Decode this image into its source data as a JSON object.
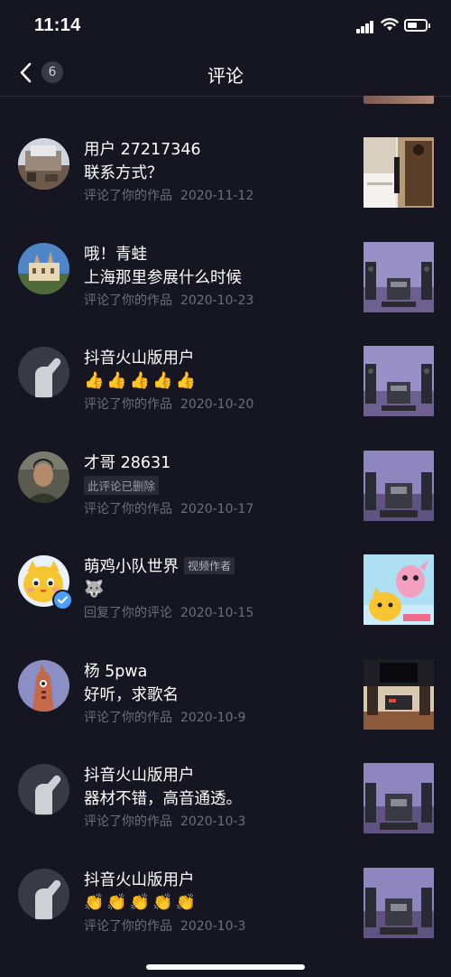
{
  "status_bar": {
    "time": "11:14"
  },
  "nav": {
    "title": "评论",
    "badge": "6"
  },
  "items": [
    {
      "name": "用户 27217346",
      "comment": "联系方式？",
      "action": "评论了你的作品",
      "date": "2020-11-12"
    },
    {
      "name": "哦！青蛙",
      "comment": "上海那里参展什么时候",
      "action": "评论了你的作品",
      "date": "2020-10-23"
    },
    {
      "name": "抖音火山版用户",
      "comment_emoji": "thumbs-up",
      "comment_emoji_count": 5,
      "action": "评论了你的作品",
      "date": "2020-10-20"
    },
    {
      "name": "才哥 28631",
      "deleted_label": "此评论已删除",
      "action": "评论了你的作品",
      "date": "2020-10-17"
    },
    {
      "name": "萌鸡小队世界",
      "author_tag": "视频作者",
      "comment_emoji": "wolf-face",
      "verified": true,
      "action": "回复了你的评论",
      "date": "2020-10-15"
    },
    {
      "name": "杨 5pwa",
      "comment": "好听，求歌名",
      "action": "评论了你的作品",
      "date": "2020-10-9"
    },
    {
      "name": "抖音火山版用户",
      "comment": "器材不错，高音通透。",
      "action": "评论了你的作品",
      "date": "2020-10-3"
    },
    {
      "name": "抖音火山版用户",
      "comment_emoji": "clapping-hands",
      "comment_emoji_count": 5,
      "action": "评论了你的作品",
      "date": "2020-10-3"
    }
  ],
  "colors": {
    "background": "#161622",
    "meta_text": "#6e6e7a",
    "verified": "#4a9eff"
  }
}
